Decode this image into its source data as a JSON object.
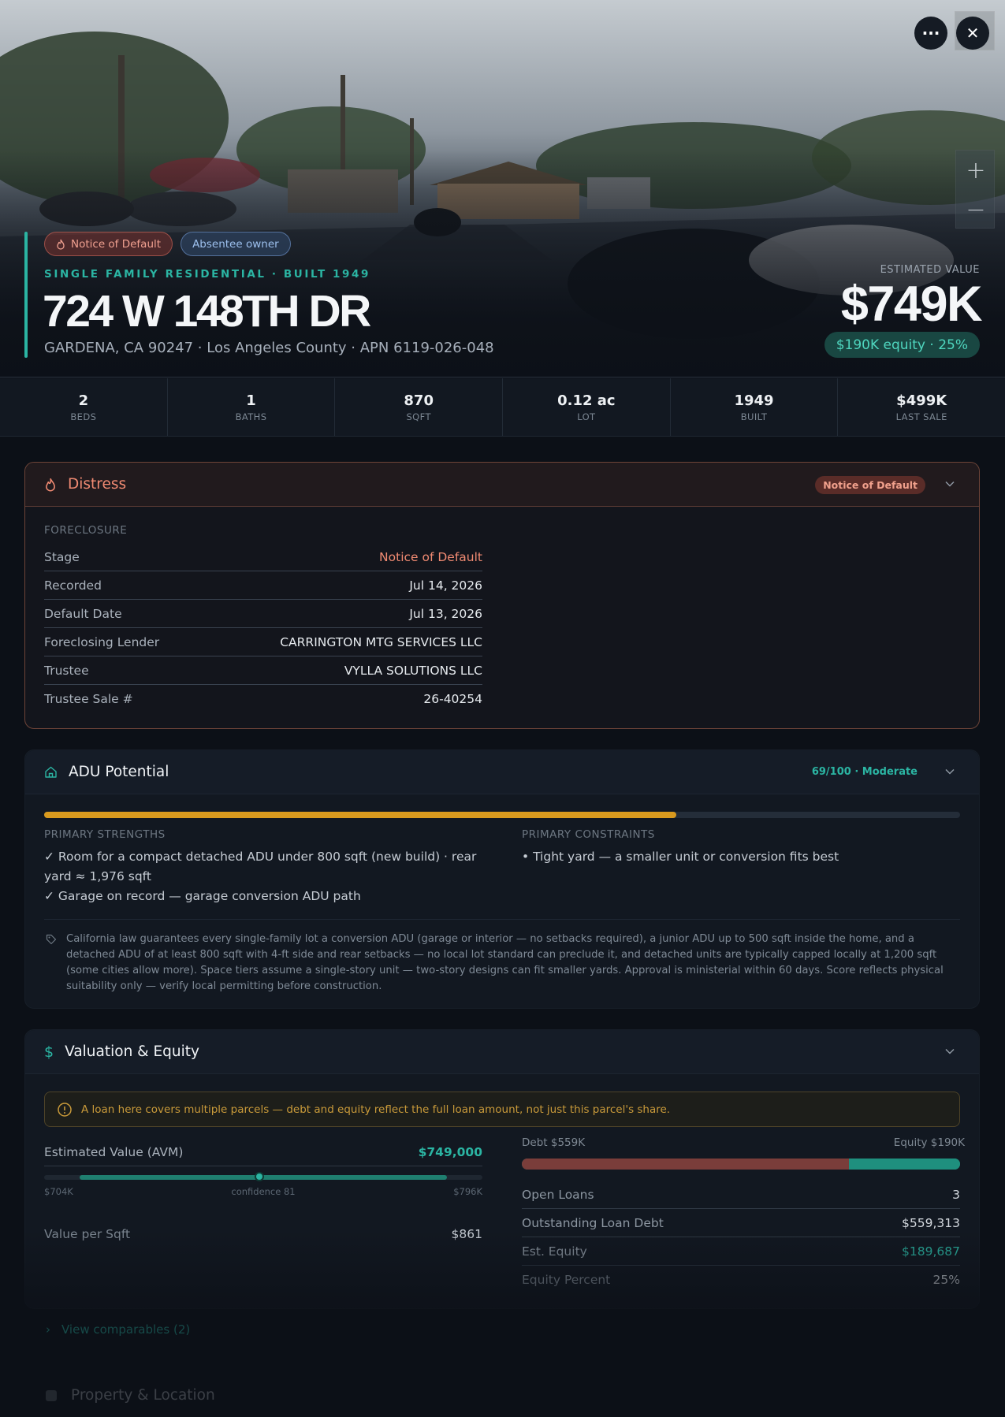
{
  "hero": {
    "badges": [
      {
        "label": "Notice of Default",
        "icon": "flame-icon"
      },
      {
        "label": "Absentee owner"
      }
    ],
    "subtitle": "SINGLE FAMILY RESIDENTIAL · BUILT 1949",
    "title": "724 W 148TH DR",
    "address": "GARDENA, CA 90247 · Los Angeles County · APN 6119-026-048",
    "estimated_value_label": "ESTIMATED VALUE",
    "estimated_value": "$749K",
    "equity_pill": "$190K equity · 25%",
    "more_icon": "···",
    "close_icon": "✕",
    "zoom_in": "+",
    "zoom_out": "−"
  },
  "stats": [
    {
      "value": "2",
      "label": "BEDS"
    },
    {
      "value": "1",
      "label": "BATHS"
    },
    {
      "value": "870",
      "label": "SQFT"
    },
    {
      "value": "0.12 ac",
      "label": "LOT"
    },
    {
      "value": "1949",
      "label": "BUILT"
    },
    {
      "value": "$499K",
      "label": "LAST SALE"
    }
  ],
  "distress": {
    "title": "Distress",
    "badge": "Notice of Default",
    "section": "FORECLOSURE",
    "rows": [
      {
        "k": "Stage",
        "v": "Notice of Default"
      },
      {
        "k": "Recorded",
        "v": "Jul 14, 2026"
      },
      {
        "k": "Default Date",
        "v": "Jul 13, 2026"
      },
      {
        "k": "Foreclosing Lender",
        "v": "CARRINGTON MTG SERVICES LLC"
      },
      {
        "k": "Trustee",
        "v": "VYLLA SOLUTIONS LLC"
      },
      {
        "k": "Trustee Sale #",
        "v": "26-40254"
      }
    ]
  },
  "adu": {
    "title": "ADU Potential",
    "score_label": "69/100 · Moderate",
    "score": 69,
    "strengths_caption": "PRIMARY STRENGTHS",
    "strengths": [
      "✓ Room for a compact detached ADU under 800 sqft (new build) · rear yard ≈ 1,976 sqft",
      "✓ Garage on record — garage conversion ADU path"
    ],
    "constraints_caption": "PRIMARY CONSTRAINTS",
    "constraints": [
      "• Tight yard — a smaller unit or conversion fits best"
    ],
    "note": "California law guarantees every single-family lot a conversion ADU (garage or interior — no setbacks required), a junior ADU up to 500 sqft inside the home, and a detached ADU of at least 800 sqft with 4-ft side and rear setbacks — no local lot standard can preclude it, and detached units are typically capped locally at 1,200 sqft (some cities allow more). Space tiers assume a single-story unit — two-story designs can fit smaller yards. Approval is ministerial within 60 days. Score reflects physical suitability only — verify local permitting before construction."
  },
  "valuation": {
    "title": "Valuation & Equity",
    "warning": "A loan here covers multiple parcels — debt and equity reflect the full loan amount, not just this parcel's share.",
    "avm_label": "Estimated Value (AVM)",
    "avm_value": "$749,000",
    "range_low": "$704K",
    "range_confidence": "confidence 81",
    "range_high": "$796K",
    "range": {
      "low": 704,
      "high": 796,
      "value": 749
    },
    "vps_label": "Value per Sqft",
    "vps_value": "$861",
    "debt_label": "Debt $559K",
    "equity_label": "Equity $190K",
    "debt_fraction": 0.747,
    "rows": [
      {
        "k": "Open Loans",
        "v": "3"
      },
      {
        "k": "Outstanding Loan Debt",
        "v": "$559,313"
      },
      {
        "k": "Est. Equity",
        "v": "$189,687"
      },
      {
        "k": "Equity Percent",
        "v": "25%"
      }
    ]
  },
  "footer": {
    "comparables": "View comparables (2)",
    "property_location": "Property & Location"
  },
  "colors": {
    "accent": "#2bb5a3",
    "distress": "#f08a72",
    "adu_bar": "#d99a1e",
    "debt": "#7a3d3a"
  }
}
